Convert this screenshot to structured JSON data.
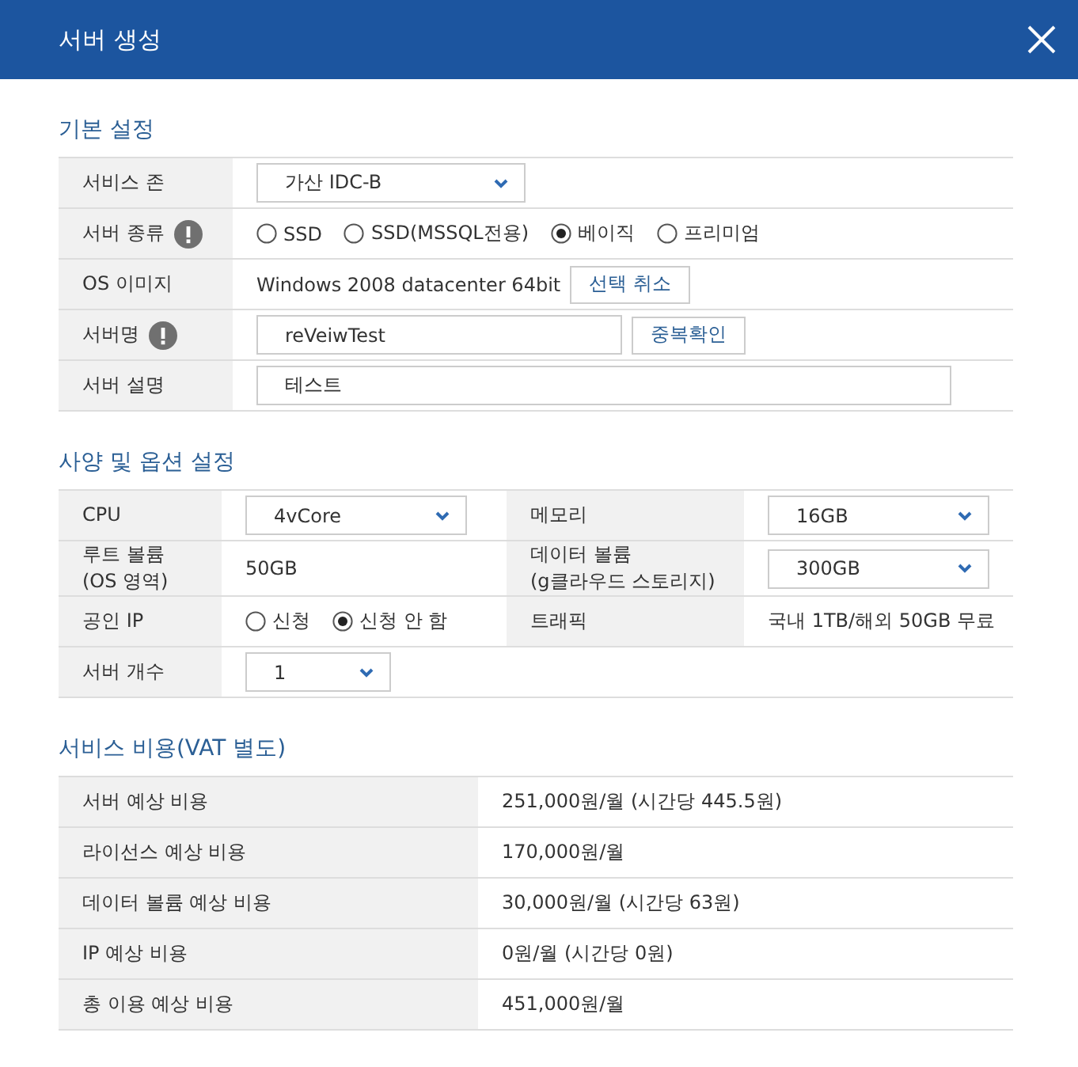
{
  "window": {
    "title": "서버 생성"
  },
  "basic": {
    "title": "기본 설정",
    "rows": [
      {
        "label": "서비스 존",
        "info": false,
        "kind": "select",
        "value": "가산 IDC-B"
      },
      {
        "label": "서버 종류",
        "info": true,
        "kind": "radios",
        "options": [
          {
            "label": "SSD",
            "selected": false
          },
          {
            "label": "SSD(MSSQL전용)",
            "selected": false
          },
          {
            "label": "베이직",
            "selected": true
          },
          {
            "label": "프리미엄",
            "selected": false
          }
        ]
      },
      {
        "label": "OS 이미지",
        "info": false,
        "kind": "text_button",
        "value": "Windows 2008 datacenter 64bit",
        "button": "선택 취소"
      },
      {
        "label": "서버명",
        "info": true,
        "kind": "input_button",
        "value": "reVeiwTest",
        "button": "중복확인"
      },
      {
        "label": "서버 설명",
        "info": false,
        "kind": "input",
        "value": "테스트"
      }
    ]
  },
  "spec": {
    "title": "사양 및 옵션 설정",
    "rows": [
      {
        "items": [
          {
            "label": "CPU",
            "kind": "select",
            "value": "4vCore"
          },
          {
            "label": "메모리",
            "kind": "select",
            "value": "16GB"
          }
        ]
      },
      {
        "items": [
          {
            "label": "루트 볼륨\n(OS 영역)",
            "kind": "text",
            "value": "50GB"
          },
          {
            "label": "데이터 볼륨\n(g클라우드 스토리지)",
            "kind": "select",
            "value": "300GB"
          }
        ]
      },
      {
        "items": [
          {
            "label": "공인 IP",
            "kind": "radios",
            "options": [
              {
                "label": "신청",
                "selected": false
              },
              {
                "label": "신청 안 함",
                "selected": true
              }
            ]
          },
          {
            "label": "트래픽",
            "kind": "text",
            "value": "국내 1TB/해외 50GB 무료"
          }
        ]
      },
      {
        "items": [
          {
            "label": "서버 개수",
            "kind": "select",
            "value": "1"
          }
        ]
      }
    ]
  },
  "cost": {
    "title": "서비스 비용(VAT 별도)",
    "rows": [
      {
        "label": "서버 예상 비용",
        "value": "251,000원/월 (시간당 445.5원)"
      },
      {
        "label": "라이선스 예상 비용",
        "value": "170,000원/월"
      },
      {
        "label": "데이터 볼륨 예상 비용",
        "value": "30,000원/월 (시간당 63원)"
      },
      {
        "label": "IP 예상 비용",
        "value": "0원/월 (시간당 0원)"
      },
      {
        "label": "총 이용 예상 비용",
        "value": "451,000원/월"
      }
    ]
  }
}
